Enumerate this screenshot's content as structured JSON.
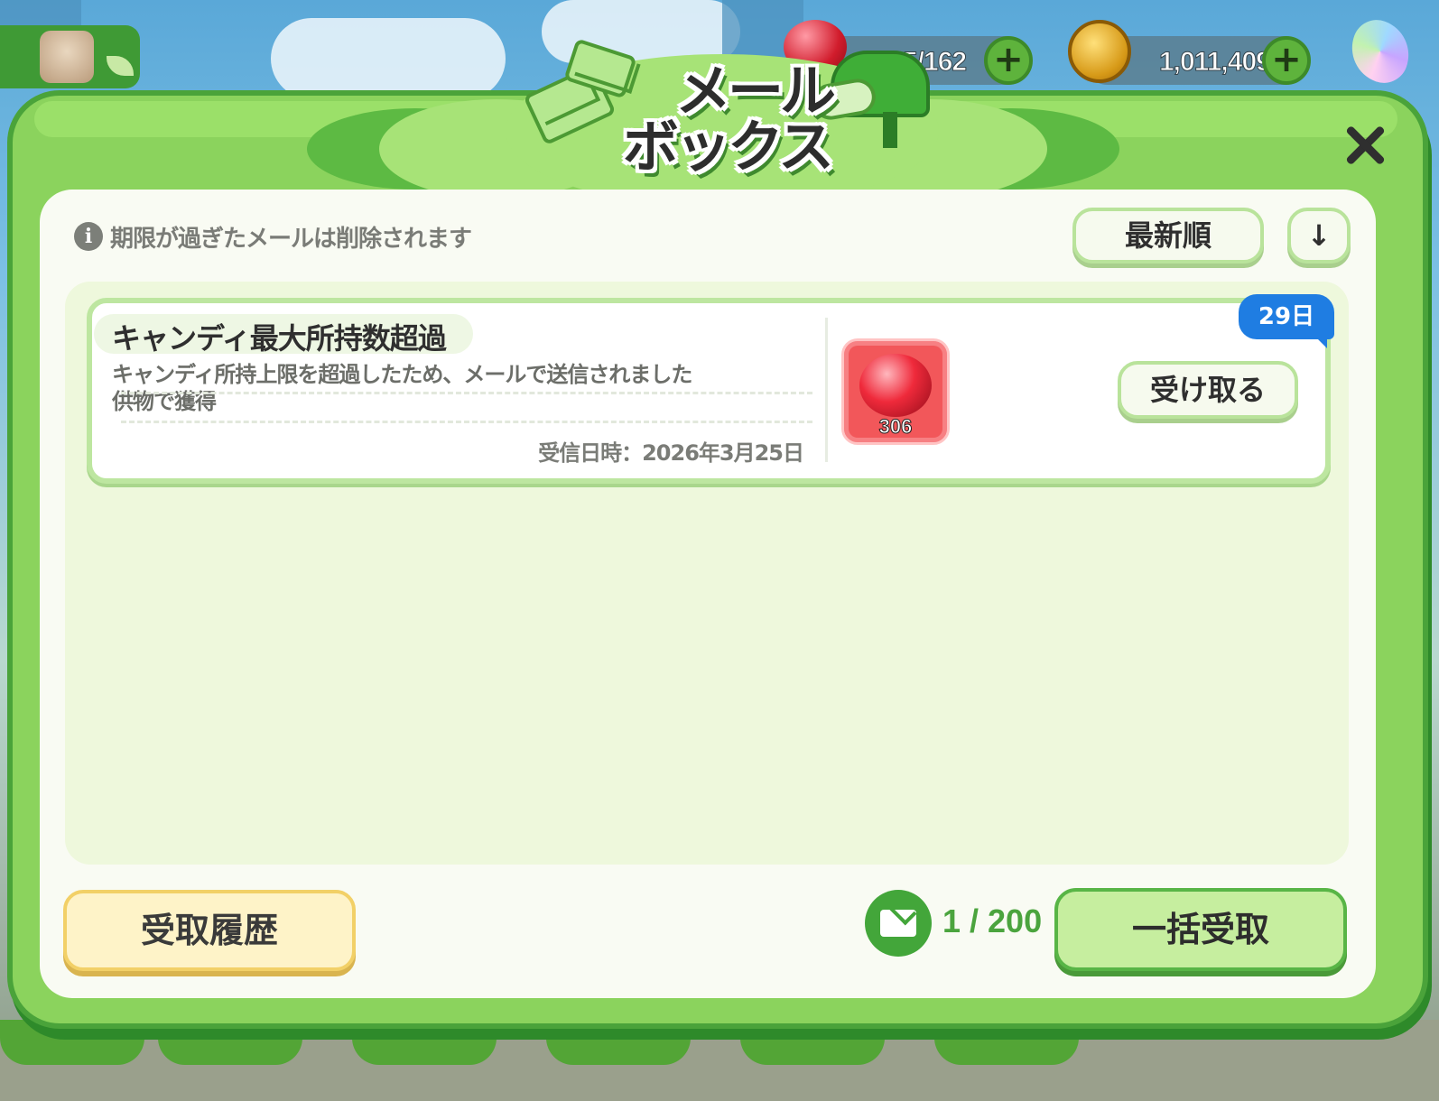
{
  "header": {
    "title_line1": "メール",
    "title_line2": "ボックス"
  },
  "resources": {
    "candy": "5/162",
    "coins": "1,011,409",
    "add_symbol": "+"
  },
  "info": {
    "icon_glyph": "i",
    "notice": "期限が過ぎたメールは削除されます"
  },
  "controls": {
    "sort_label": "最新順",
    "order_glyph": "↓"
  },
  "mails": [
    {
      "title": "キャンディ最大所持数超過",
      "description_line1": "キャンディ所持上限を超過したため、メールで送信されました",
      "description_line2": "供物で獲得",
      "received": "受信日時：2026年3月25日",
      "reward_item": "candy",
      "reward_count": "306",
      "days_left": "29日",
      "receive_label": "受け取る"
    }
  ],
  "footer": {
    "history_label": "受取履歴",
    "mail_count": "1 / 200",
    "claim_all_label": "一括受取"
  },
  "colors": {
    "panel_green": "#8bd35d",
    "badge_blue": "#1f7de2",
    "candy_red": "#ef2a3b"
  }
}
